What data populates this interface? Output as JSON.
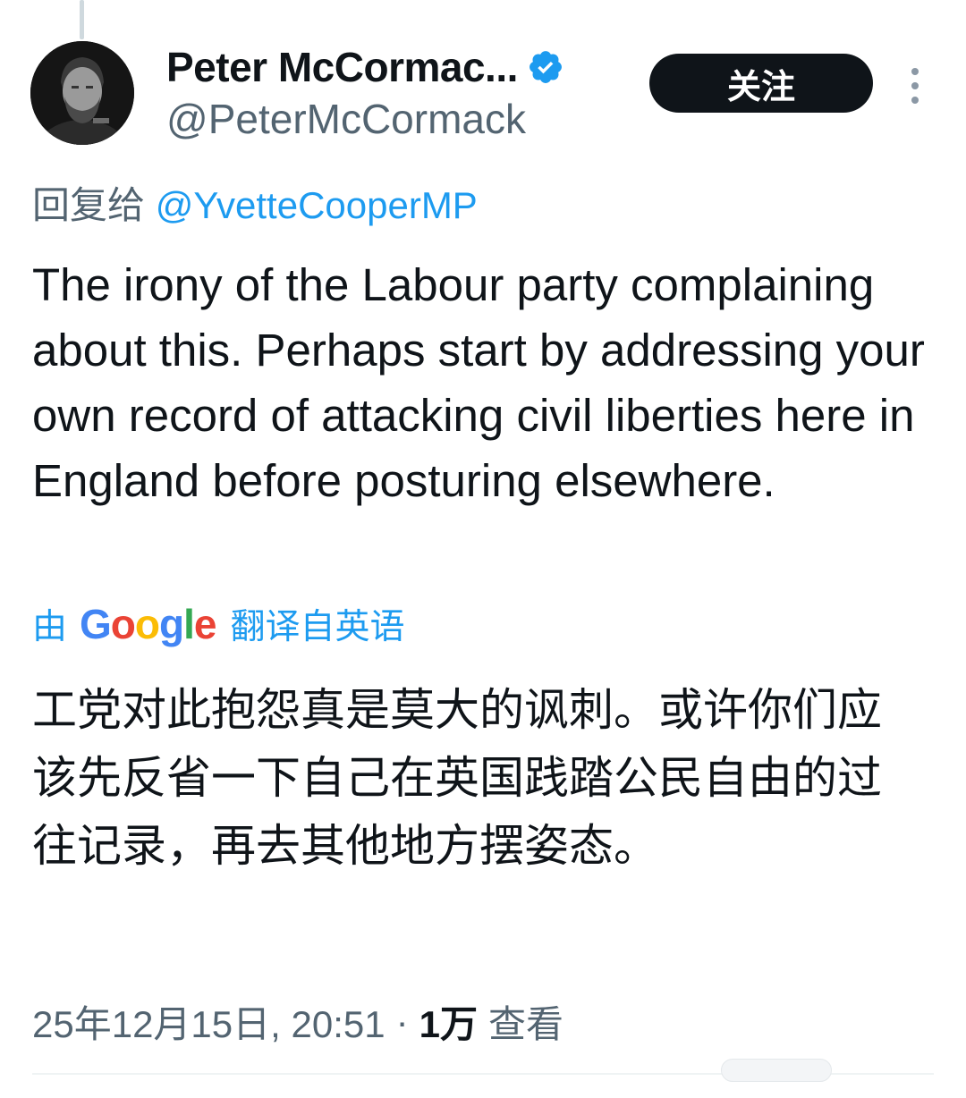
{
  "author": {
    "display_name": "Peter McCormac...",
    "handle": "@PeterMcCormack",
    "verified_icon": "verified-badge-icon",
    "avatar_icon": "avatar-photo"
  },
  "actions": {
    "follow_label": "关注",
    "more_icon": "more-vertical-icon"
  },
  "reply": {
    "prefix": "回复给",
    "mention": "@YvetteCooperMP"
  },
  "tweet": {
    "text": "The irony of the Labour party complaining about this. Perhaps start by addressing your own record of attacking civil liberties here in England before posturing elsewhere."
  },
  "translation": {
    "prefix": "由",
    "provider": "Google",
    "suffix": "翻译自英语",
    "text": "工党对此抱怨真是莫大的讽刺。或许你们应该先反省一下自己在英国践踏公民自由的过往记录，再去其他地方摆姿态。"
  },
  "meta": {
    "timestamp": "25年12月15日, 20:51",
    "separator": "·",
    "views_count": "1万",
    "views_label": "查看"
  },
  "colors": {
    "accent": "#1d9bf0",
    "text": "#0f1419",
    "muted": "#536471",
    "button_bg": "#0f1419"
  }
}
